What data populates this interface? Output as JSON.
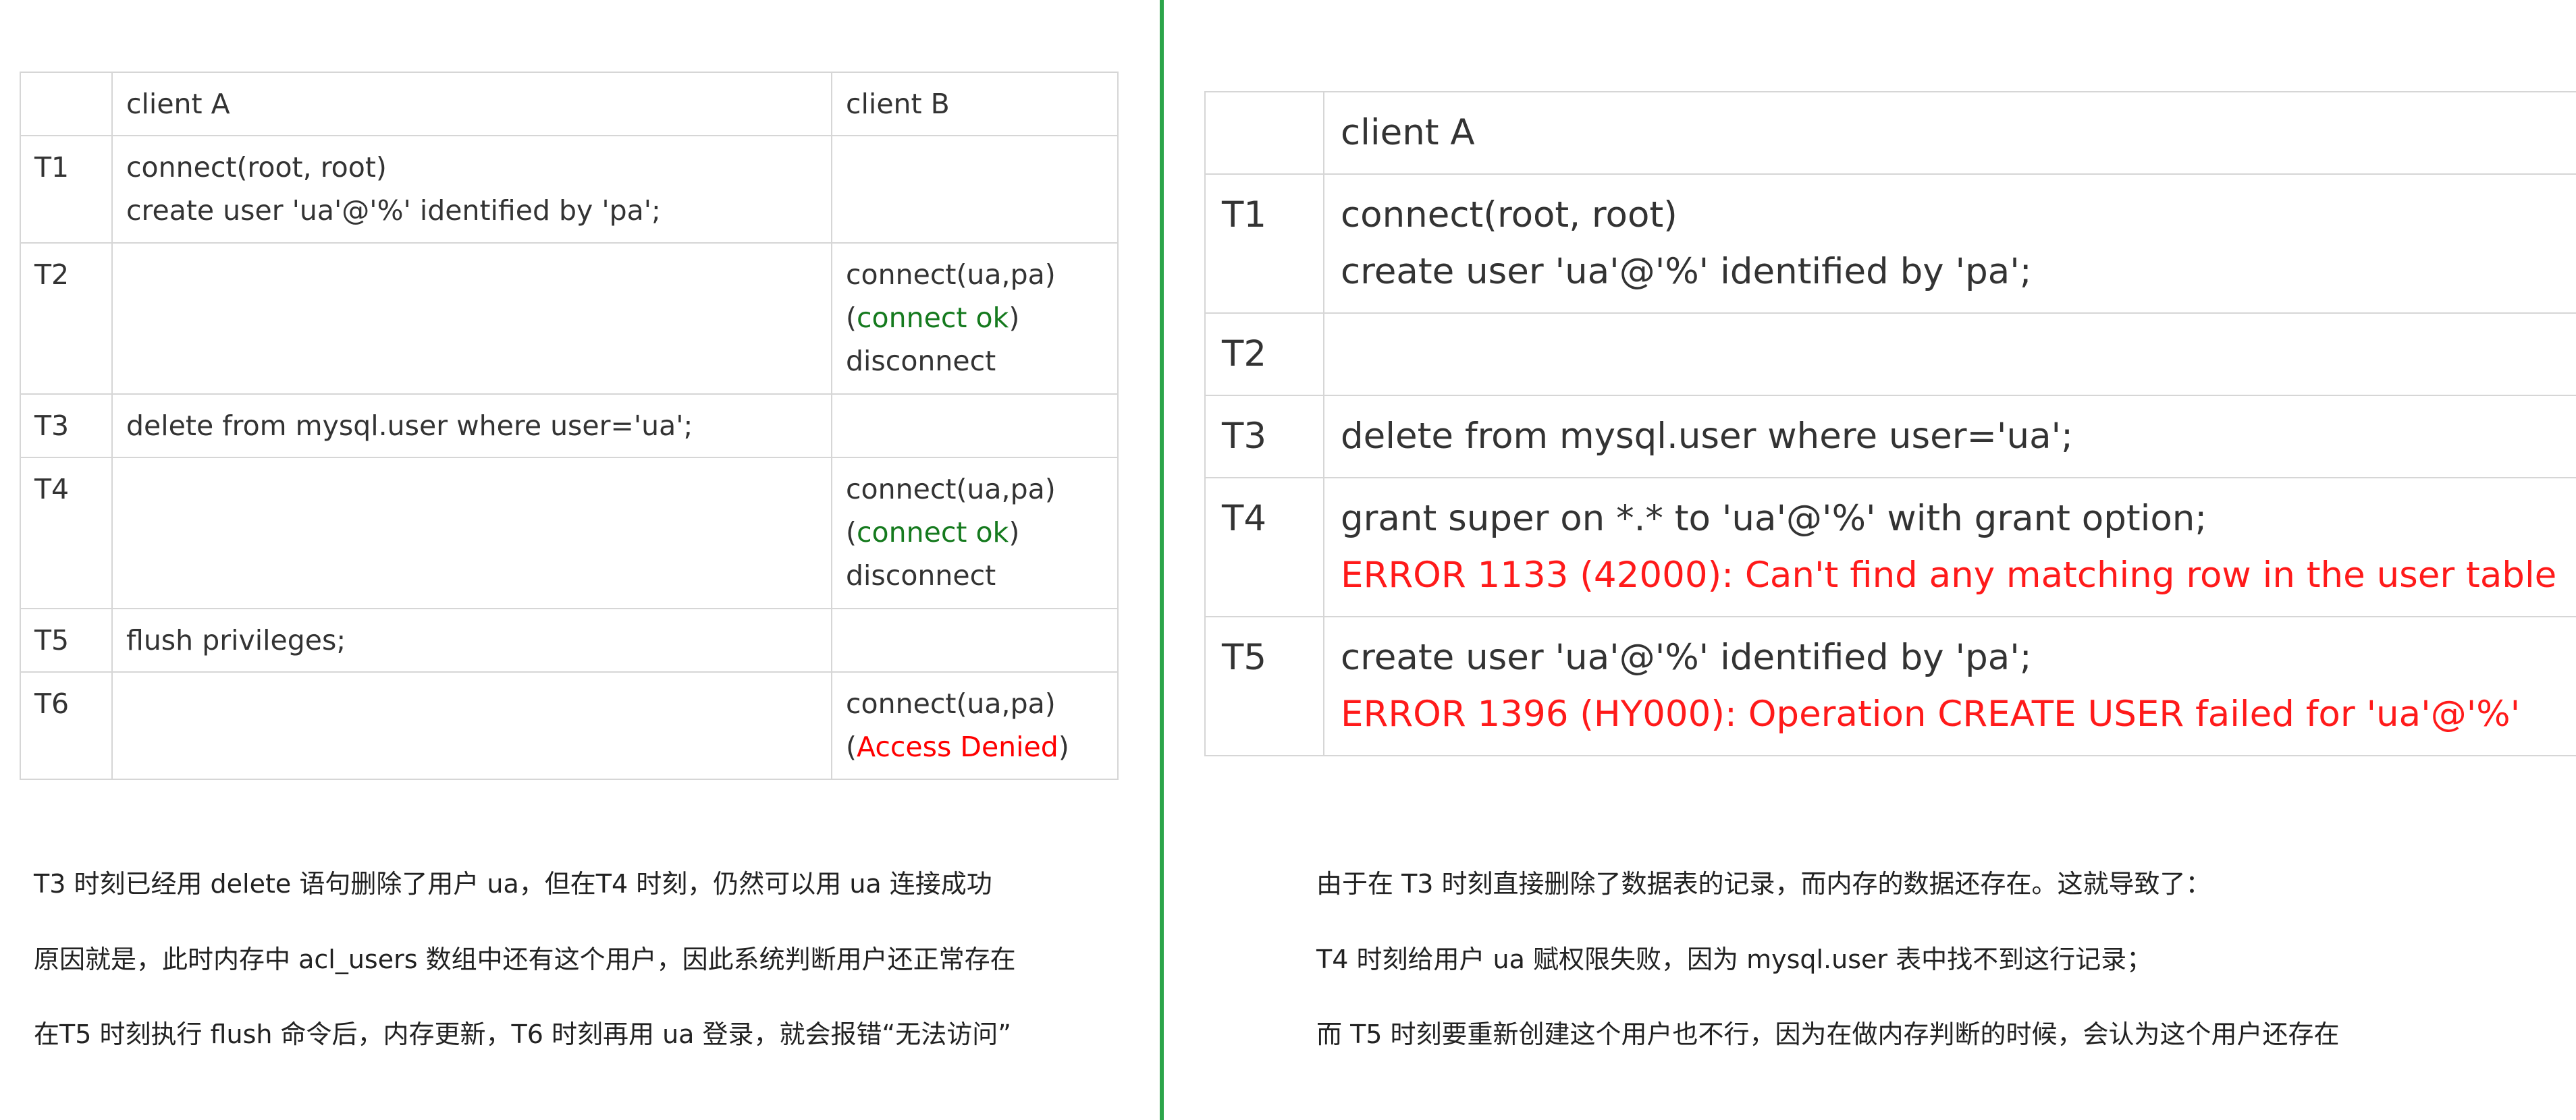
{
  "left": {
    "table": {
      "header": {
        "client_a": "client A",
        "client_b": "client B"
      },
      "rows": {
        "t1": {
          "label": "T1",
          "a_line1": "connect(root, root)",
          "a_line2": "create user 'ua'@'%' identified by 'pa';"
        },
        "t2": {
          "label": "T2",
          "b_line1": "connect(ua,pa)",
          "b_open": "(",
          "b_status": "connect ok",
          "b_close": ")",
          "b_line3": "disconnect"
        },
        "t3": {
          "label": "T3",
          "a_line1": "delete from mysql.user where user='ua';"
        },
        "t4": {
          "label": "T4",
          "b_line1": "connect(ua,pa)",
          "b_open": "(",
          "b_status": "connect ok",
          "b_close": ")",
          "b_line3": "disconnect"
        },
        "t5": {
          "label": "T5",
          "a_line1": "flush privileges;"
        },
        "t6": {
          "label": "T6",
          "b_line1": "connect(ua,pa)",
          "b_open": "(",
          "b_status": "Access Denied",
          "b_close": ")"
        }
      }
    },
    "notes": [
      "T3 时刻已经用 delete 语句删除了用户 ua，但在T4 时刻，仍然可以用 ua 连接成功",
      "原因就是，此时内存中 acl_users 数组中还有这个用户，因此系统判断用户还正常存在",
      "在T5 时刻执行 flush 命令后，内存更新，T6 时刻再用 ua 登录，就会报错“无法访问”"
    ]
  },
  "right": {
    "table": {
      "header": {
        "client_a": "client A"
      },
      "rows": {
        "t1": {
          "label": "T1",
          "line1": "connect(root, root)",
          "line2": "create user 'ua'@'%' identified by 'pa';"
        },
        "t2": {
          "label": "T2"
        },
        "t3": {
          "label": "T3",
          "line1": "delete from mysql.user where user='ua';"
        },
        "t4": {
          "label": "T4",
          "line1": "grant super on *.* to 'ua'@'%' with grant option;",
          "error": "ERROR 1133 (42000): Can't find any matching row in the user table"
        },
        "t5": {
          "label": "T5",
          "line1": "create user 'ua'@'%' identified by 'pa';",
          "error": "ERROR 1396 (HY000): Operation CREATE USER failed for 'ua'@'%'"
        }
      }
    },
    "notes": [
      "由于在 T3 时刻直接删除了数据表的记录，而内存的数据还存在。这就导致了：",
      "T4 时刻给用户 ua 赋权限失败，因为 mysql.user 表中找不到这行记录；",
      "而 T5 时刻要重新创建这个用户也不行，因为在做内存判断的时候，会认为这个用户还存在"
    ]
  },
  "colors": {
    "divider": "#2ca54a",
    "ok_text": "#157a1e",
    "denied_text": "#ff0000",
    "table_border": "#d6d6d6"
  }
}
